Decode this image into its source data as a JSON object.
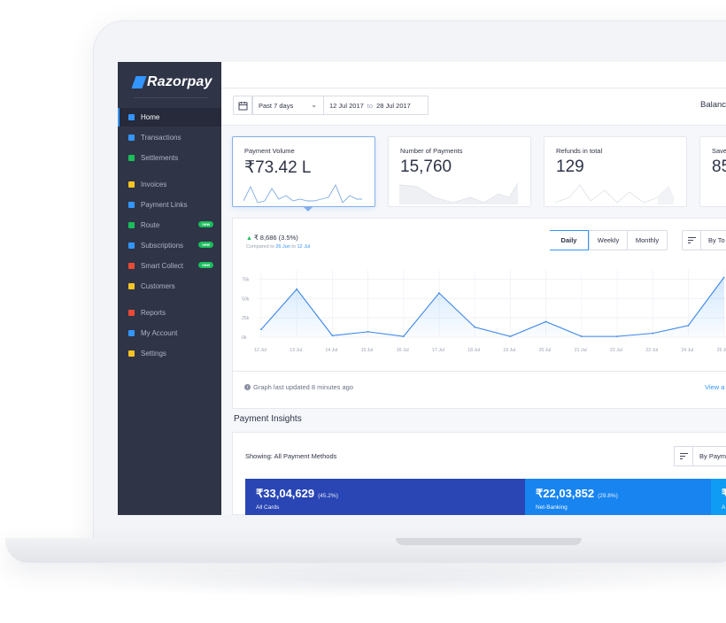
{
  "colors": {
    "brand": "#3395ff",
    "sidebar_bg": "#2f3447",
    "new_badge": "#19be5a",
    "card_blue": "#2946b4",
    "netbanking_blue": "#1784f0",
    "third_blue": "#0f9cf5"
  },
  "brand": {
    "name": "Razorpay"
  },
  "sidebar": {
    "items": [
      {
        "label": "Home",
        "icon": "home-icon",
        "icon_color": "#3395ff"
      },
      {
        "label": "Transactions",
        "icon": "transactions-icon",
        "icon_color": "#3395ff"
      },
      {
        "label": "Settlements",
        "icon": "settlements-icon",
        "icon_color": "#19be5a"
      },
      {
        "label": "Invoices",
        "icon": "invoices-icon",
        "icon_color": "#f5c423"
      },
      {
        "label": "Payment Links",
        "icon": "link-icon",
        "icon_color": "#3395ff"
      },
      {
        "label": "Route",
        "icon": "route-icon",
        "icon_color": "#19be5a",
        "badge": "new"
      },
      {
        "label": "Subscriptions",
        "icon": "subscriptions-icon",
        "icon_color": "#3395ff",
        "badge": "new"
      },
      {
        "label": "Smart Collect",
        "icon": "smart-collect-icon",
        "icon_color": "#e94b35",
        "badge": "new"
      },
      {
        "label": "Customers",
        "icon": "customers-icon",
        "icon_color": "#f5c423"
      },
      {
        "label": "Reports",
        "icon": "reports-icon",
        "icon_color": "#e94b35"
      },
      {
        "label": "My Account",
        "icon": "account-icon",
        "icon_color": "#3395ff"
      },
      {
        "label": "Settings",
        "icon": "settings-icon",
        "icon_color": "#f5c423"
      }
    ]
  },
  "filter": {
    "period": "Past 7 days",
    "from": "12 Jul 2017",
    "to_word": "to",
    "to": "28 Jul 2017",
    "balance_label": "Balanc"
  },
  "cards": [
    {
      "label": "Payment Volume",
      "value": "₹73.42 L"
    },
    {
      "label": "Number of Payments",
      "value": "15,760"
    },
    {
      "label": "Refunds in total",
      "value": "129"
    },
    {
      "label": "Save",
      "value": "85"
    }
  ],
  "chart_panel": {
    "delta": "₹ 8,686 (3.5%)",
    "compare_prefix": "Compared to",
    "compare_from": "26 Jun",
    "compare_to_word": "to",
    "compare_to": "12 Jul",
    "toggles": [
      "Daily",
      "Weekly",
      "Monthly"
    ],
    "sort_by": "By To",
    "updated": "Graph last updated 8 minutes ago",
    "view_all": "View a"
  },
  "chart_data": {
    "type": "area",
    "categories": [
      "12 Jul",
      "13 Jul",
      "14 Jul",
      "15 Jul",
      "16 Jul",
      "17 Jul",
      "18 Jul",
      "19 Jul",
      "20 Jul",
      "21 Jul",
      "22 Jul",
      "23 Jul",
      "24 Jul",
      "25 Jul"
    ],
    "values": [
      10000,
      62000,
      2000,
      7000,
      1000,
      57000,
      13000,
      1000,
      20000,
      1000,
      1000,
      5000,
      15000,
      77000
    ],
    "y_ticks": [
      "0k",
      "25k",
      "50k",
      "75k"
    ],
    "ylim": [
      0,
      80000
    ],
    "grid": true
  },
  "insights": {
    "title": "Payment Insights",
    "showing_label": "Showing:",
    "showing_value": "All Payment Methods",
    "sort_by": "By Payme",
    "methods": [
      {
        "amount": "₹33,04,629",
        "pct": "(45.2%)",
        "name": "All Cards",
        "color": "#2946b4"
      },
      {
        "amount": "₹22,03,852",
        "pct": "(29.8%)",
        "name": "Net-Banking",
        "color": "#1784f0"
      },
      {
        "amount": "₹",
        "pct": "",
        "name": "A",
        "color": "#0f9cf5"
      }
    ]
  }
}
